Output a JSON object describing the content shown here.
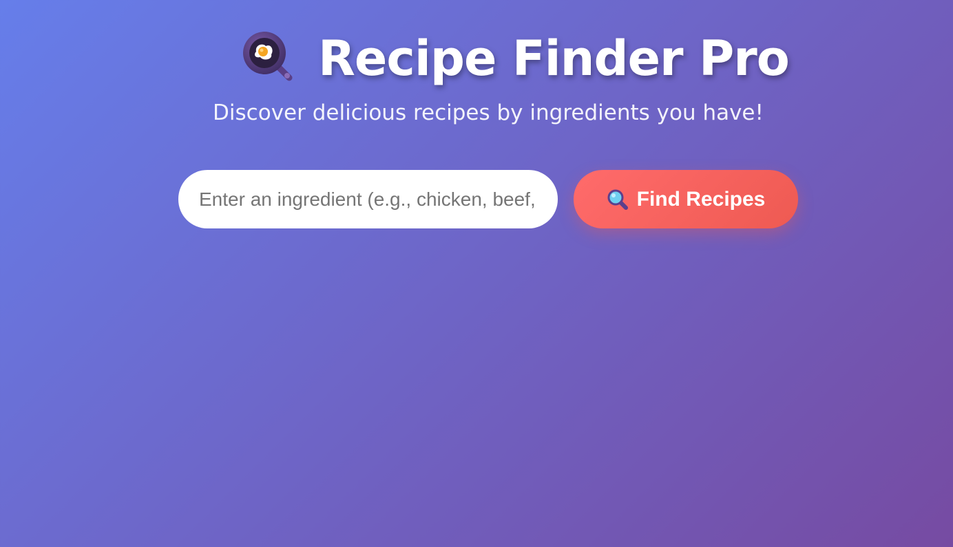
{
  "header": {
    "title": "Recipe Finder Pro",
    "title_icon": "frying-pan-egg-icon",
    "subtitle": "Discover delicious recipes by ingredients you have!"
  },
  "search": {
    "value": "",
    "placeholder": "Enter an ingredient (e.g., chicken, beef, pasta)",
    "button_label": "Find Recipes",
    "button_icon": "magnifying-glass-icon"
  },
  "colors": {
    "background_start": "#667eea",
    "background_end": "#764ba2",
    "button_start": "#ff6b6b",
    "button_end": "#ee5a52",
    "title_text": "#ffffff"
  }
}
